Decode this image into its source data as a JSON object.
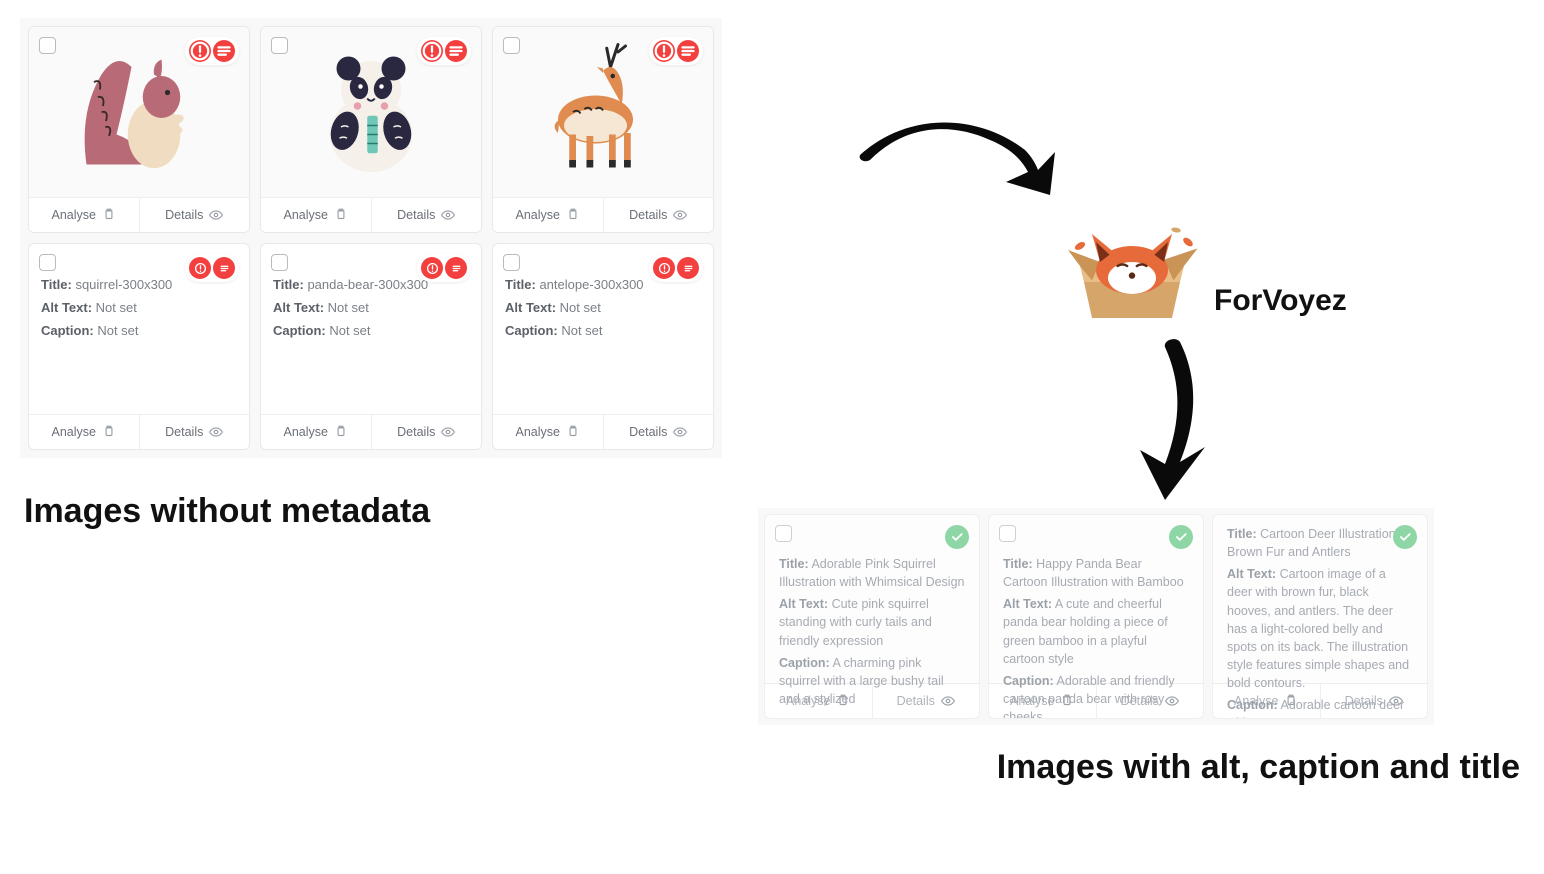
{
  "labels": {
    "analyse": "Analyse",
    "details": "Details",
    "title": "Title:",
    "alt": "Alt Text:",
    "caption": "Caption:",
    "not_set": "Not set"
  },
  "headings": {
    "left": "Images without metadata",
    "right": "Images with alt, caption and title"
  },
  "brand": "ForVoyez",
  "before": {
    "items": [
      {
        "name": "squirrel",
        "title": "squirrel-300x300",
        "alt": "Not set",
        "caption": "Not set"
      },
      {
        "name": "panda",
        "title": "panda-bear-300x300",
        "alt": "Not set",
        "caption": "Not set"
      },
      {
        "name": "antelope",
        "title": "antelope-300x300",
        "alt": "Not set",
        "caption": "Not set"
      }
    ]
  },
  "after": {
    "items": [
      {
        "title": "Adorable Pink Squirrel Illustration with Whimsical Design",
        "alt": "Cute pink squirrel standing with curly tails and friendly expression",
        "caption": "A charming pink squirrel with a large bushy tail and a stylized"
      },
      {
        "title": "Happy Panda Bear Cartoon Illustration with Bamboo",
        "alt": "A cute and cheerful panda bear holding a piece of green bamboo in a playful cartoon style",
        "caption": "Adorable and friendly cartoon panda bear with rosy cheeks"
      },
      {
        "title": "Cartoon Deer Illustration - Brown Fur and Antlers",
        "alt": "Cartoon image of a deer with brown fur, black hooves, and antlers. The deer has a light-colored belly and spots on its back. The illustration style features simple shapes and bold contours.",
        "caption": "Adorable cartoon deer with"
      }
    ]
  }
}
